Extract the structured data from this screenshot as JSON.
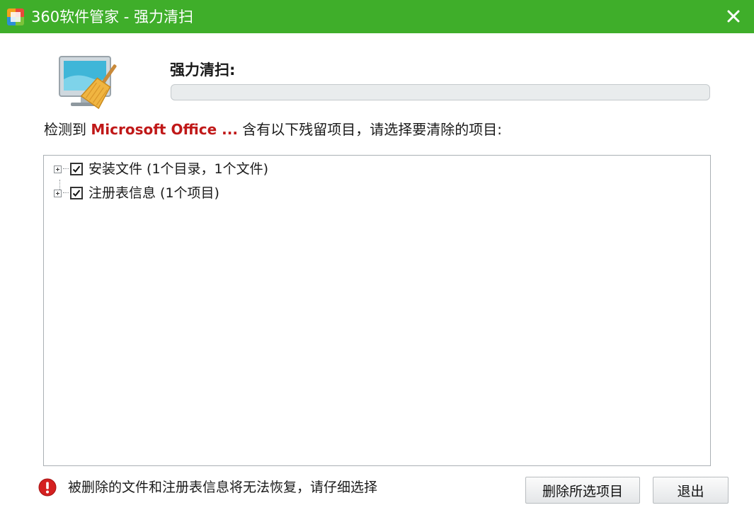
{
  "window": {
    "title": "360软件管家 - 强力清扫",
    "icon": "app-logo-icon",
    "close_icon": "close-icon"
  },
  "header": {
    "section_label": "强力清扫:",
    "progress": 0
  },
  "detect": {
    "prefix": "检测到",
    "product": "Microsoft Office ...",
    "suffix": "含有以下残留项目，请选择要清除的项目:"
  },
  "tree": {
    "items": [
      {
        "label": "安装文件 (1个目录，1个文件)",
        "checked": true,
        "expanded": false
      },
      {
        "label": "注册表信息 (1个项目)",
        "checked": true,
        "expanded": false
      }
    ]
  },
  "footer": {
    "warning": "被删除的文件和注册表信息将无法恢复，请仔细选择",
    "delete_button": "删除所选项目",
    "exit_button": "退出"
  },
  "colors": {
    "titlebar": "#3fae2a",
    "accent_red": "#c01818",
    "warning_red": "#d42020"
  }
}
